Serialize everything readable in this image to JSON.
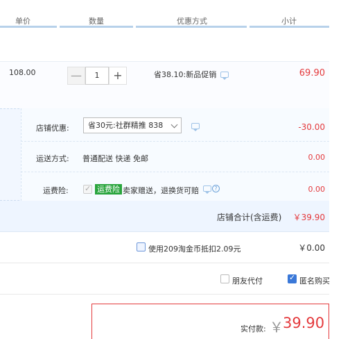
{
  "header": {
    "col_price": "单价",
    "col_qty": "数量",
    "col_discount": "优惠方式",
    "col_subtotal": "小计"
  },
  "item": {
    "unit_price": "108.00",
    "qty_minus": "—",
    "qty_value": "1",
    "qty_plus": "+",
    "discount_text": "省38.10:新品促销",
    "subtotal": "69.90"
  },
  "shop": {
    "coupon_label": "店铺优惠:",
    "coupon_selected": "省30元:社群精推 838",
    "coupon_value": "-30.00",
    "shipping_label": "运送方式:",
    "shipping_value": "普通配送 快递 免邮",
    "shipping_cost": "0.00",
    "insurance_label": "运费险:",
    "insurance_tag": "运费险",
    "insurance_text": "卖家赠送，退换货可赔",
    "insurance_cost": "0.00",
    "total_label": "店铺合计(含运费)",
    "total_value": "￥39.90"
  },
  "coins": {
    "label": "使用209淘金币抵扣2.09元",
    "value": "￥0.00"
  },
  "options": {
    "friend_pay_label": "朋友代付",
    "anonymous_label": "匿名购买"
  },
  "payment": {
    "label": "实付款:",
    "currency": "￥",
    "amount": "39.90"
  },
  "colors": {
    "accent_red": "#e4393c",
    "header_line": "#b7d1ea",
    "check_blue": "#3a78d8",
    "insurance_green": "#2aa53d"
  }
}
